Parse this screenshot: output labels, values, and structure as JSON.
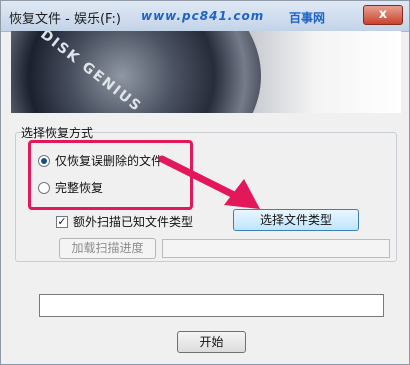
{
  "window": {
    "title": "恢复文件 - 娱乐(F:)",
    "close_label": "x"
  },
  "watermark": {
    "site": "www.pc841.com",
    "name": "百事网"
  },
  "banner": {
    "logo_text": "DISK GENIUS"
  },
  "recover_mode": {
    "group_label": "选择恢复方式",
    "options": [
      {
        "label": "仅恢复误删除的文件",
        "selected": true
      },
      {
        "label": "完整恢复",
        "selected": false
      }
    ]
  },
  "extra_scan": {
    "label": "额外扫描已知文件类型",
    "checked": true,
    "check_mark": "✓"
  },
  "buttons": {
    "select_file_type": "选择文件类型",
    "load_progress": "加载扫描进度",
    "start": "开始"
  },
  "path_field": {
    "value": ""
  },
  "colors": {
    "highlight": "#e2185b",
    "arrow": "#e2185b",
    "watermark": "#1f63c6"
  }
}
